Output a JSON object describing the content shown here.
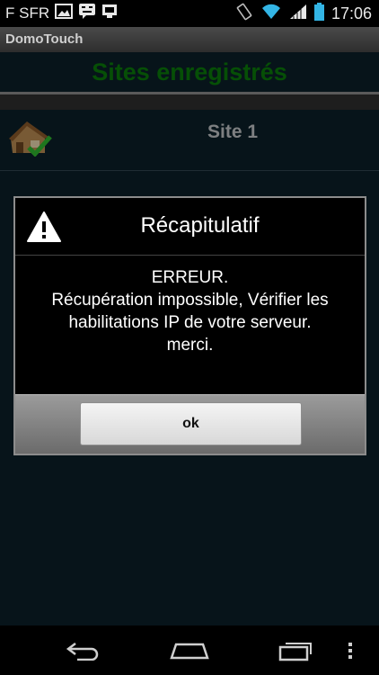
{
  "status_bar": {
    "carrier": "F SFR",
    "time": "17:06",
    "icons": [
      "image-icon",
      "message-icon",
      "notification-icon",
      "vibrate-icon",
      "wifi-icon",
      "signal-icon",
      "battery-icon"
    ]
  },
  "app": {
    "title": "DomoTouch",
    "heading": "Sites enregistrés",
    "sites": [
      {
        "name": "Site 1",
        "icon": "house-check-icon"
      }
    ]
  },
  "dialog": {
    "title": "Récapitulatif",
    "icon": "warning-icon",
    "message": "ERREUR.\nRécupération impossible, Vérifier les habilitations IP de votre serveur.\nmerci.",
    "ok_label": "ok"
  },
  "nav_bar": {
    "buttons": [
      "back-icon",
      "home-icon",
      "recent-apps-icon",
      "menu-icon"
    ]
  },
  "colors": {
    "heading_green": "#0a7a0a",
    "app_background": "#0b1f28",
    "statusbar_accent": "#33b5e5"
  }
}
